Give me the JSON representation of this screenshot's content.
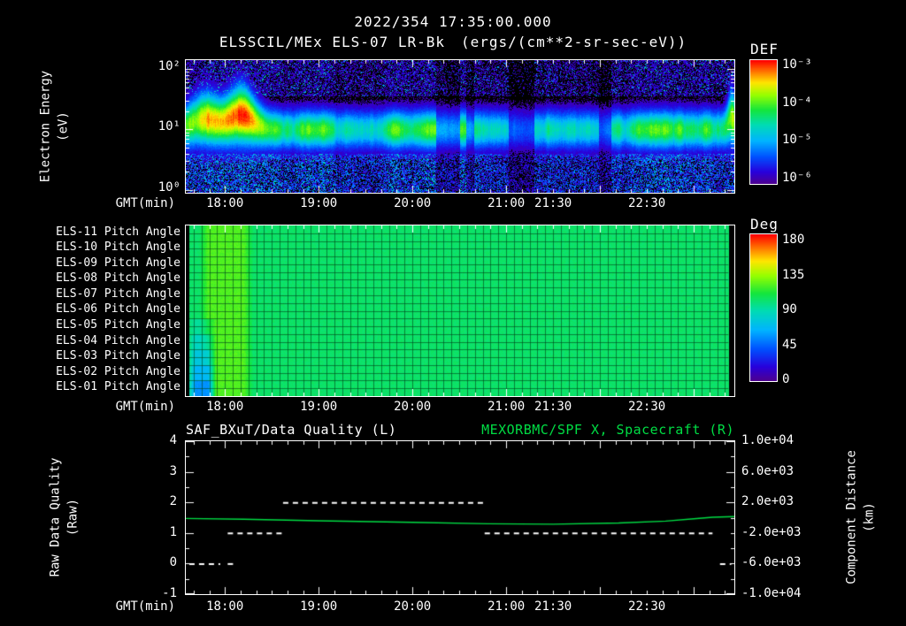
{
  "header": {
    "timestamp": "2022/354 17:35:00.000",
    "title": "ELSSCIL/MEx ELS-07 LR-Bk",
    "units": "(ergs/(cm**2-sr-sec-eV))"
  },
  "time_axis": {
    "label": "GMT(min)",
    "start_hours": 17.583,
    "end_hours": 23.433,
    "ticks": [
      {
        "t": 18.0,
        "label": "18:00"
      },
      {
        "t": 19.0,
        "label": "19:00"
      },
      {
        "t": 20.0,
        "label": "20:00"
      },
      {
        "t": 21.0,
        "label": "21:00"
      },
      {
        "t": 21.5,
        "label": "21:30"
      },
      {
        "t": 22.5,
        "label": "22:30"
      }
    ]
  },
  "chart_data": [
    {
      "id": "energy_spectrogram",
      "type": "heatmap",
      "ylabel_lines": [
        "Electron Energy",
        "(eV)"
      ],
      "y_log_range": [
        2.15,
        -0.05
      ],
      "yticks": [
        {
          "logv": 2,
          "label": "10²"
        },
        {
          "logv": 1,
          "label": "10¹"
        },
        {
          "logv": 0,
          "label": "10⁰"
        }
      ],
      "colorbar": {
        "title": "DEF",
        "tick_labels": [
          "10⁻³",
          "10⁻⁴",
          "10⁻⁵",
          "10⁻⁶"
        ]
      },
      "features": {
        "band_center_log_ev": 1.0,
        "band_sigma_log": 0.3,
        "band_level": 0.68,
        "enhancements": [
          {
            "t_center": 17.78,
            "amp": 0.22,
            "t_sigma": 0.2
          },
          {
            "t_center": 18.17,
            "amp": 0.3,
            "t_sigma": 0.18
          },
          {
            "t_center": 23.4,
            "amp": 0.25,
            "t_sigma": 0.05
          }
        ],
        "dropout_intervals": [
          [
            20.25,
            20.5
          ],
          [
            20.57,
            20.65
          ],
          [
            21.02,
            21.3
          ],
          [
            21.98,
            22.12
          ]
        ]
      }
    },
    {
      "id": "pitch_angles",
      "type": "heatmap",
      "row_labels": [
        "ELS-11 Pitch Angle",
        "ELS-10 Pitch Angle",
        "ELS-09 Pitch Angle",
        "ELS-08 Pitch Angle",
        "ELS-07 Pitch Angle",
        "ELS-06 Pitch Angle",
        "ELS-05 Pitch Angle",
        "ELS-04 Pitch Angle",
        "ELS-03 Pitch Angle",
        "ELS-02 Pitch Angle",
        "ELS-01 Pitch Angle"
      ],
      "colorbar": {
        "title": "Deg",
        "tick_labels": [
          "180",
          "135",
          "90",
          "45",
          "0"
        ]
      },
      "features": {
        "data_start": 17.62,
        "data_end": 23.37,
        "base_deg": 100,
        "bright_interval": {
          "t0": 17.72,
          "t1": 18.3,
          "deg": 118
        },
        "cyan_interval": {
          "t0": 17.6,
          "t1": 17.9,
          "deg": 55
        }
      }
    },
    {
      "id": "quality_and_distance",
      "type": "line",
      "title_left": "SAF_BXuT/Data Quality (L)",
      "title_right": "MEXORBMC/SPF X, Spacecraft (R)",
      "title_right_color": "#00dd44",
      "ylabel_left_lines": [
        "Raw Data Quality",
        "(Raw)"
      ],
      "yrange_left": [
        -1,
        4
      ],
      "yticks_left": [
        "4",
        "3",
        "2",
        "1",
        "0",
        "-1"
      ],
      "ylabel_right_lines": [
        "Component Distance",
        "(km)"
      ],
      "yrange_right": [
        -10000,
        10000
      ],
      "yticks_right": [
        "1.0e+04",
        "6.0e+03",
        "2.0e+03",
        "-2.0e+03",
        "-6.0e+03",
        "-1.0e+04"
      ],
      "series": [
        {
          "name": "spacecraft_x_component_distance_km",
          "axis": "right",
          "color": "#00dd44",
          "points_t_km": [
            [
              17.583,
              -100
            ],
            [
              18.2,
              -200
            ],
            [
              19.0,
              -400
            ],
            [
              20.0,
              -600
            ],
            [
              20.8,
              -800
            ],
            [
              21.5,
              -850
            ],
            [
              22.2,
              -700
            ],
            [
              22.7,
              -450
            ],
            [
              23.0,
              -150
            ],
            [
              23.2,
              50
            ],
            [
              23.433,
              150
            ]
          ]
        }
      ],
      "quality_color": "#ffffff",
      "quality_segments": [
        {
          "level": 0,
          "t0": 17.62,
          "t1": 17.95
        },
        {
          "level": 0,
          "t0": 18.03,
          "t1": 18.09
        },
        {
          "level": 1,
          "t0": 18.03,
          "t1": 18.62
        },
        {
          "level": 2,
          "t0": 18.62,
          "t1": 20.77
        },
        {
          "level": 1,
          "t0": 20.77,
          "t1": 23.2
        },
        {
          "level": 0,
          "t0": 23.28,
          "t1": 23.4
        }
      ]
    }
  ]
}
